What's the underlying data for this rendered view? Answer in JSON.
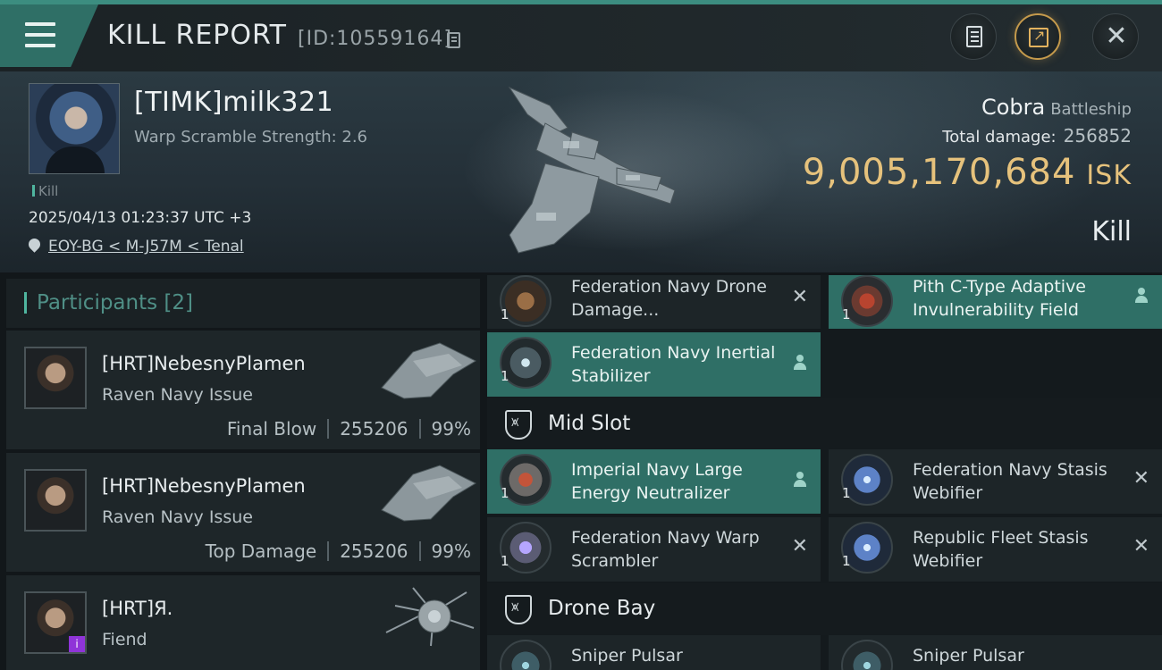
{
  "title_bar": {
    "title": "KILL REPORT",
    "report_id": "[ID:10559164]",
    "icons": [
      "menu-icon",
      "copy-icon",
      "document-icon",
      "share-icon",
      "close-icon"
    ]
  },
  "victim": {
    "name": "[TIMK]milk321",
    "warp_scramble": "Warp Scramble Strength: 2.6",
    "tag": "Kill",
    "datetime": "2025/04/13 01:23:37 UTC +3",
    "location": "EOY-BG < M-J57M < Tenal",
    "ship_name": "Cobra",
    "ship_class": "Battleship",
    "total_damage_label": "Total damage:",
    "total_damage": "256852",
    "isk_value": "9,005,170,684",
    "isk_unit": "ISK",
    "outcome": "Kill"
  },
  "participants": {
    "label": "Participants",
    "count": "[2]",
    "items": [
      {
        "name": "[HRT]NebesnyPlamen",
        "ship": "Raven Navy Issue",
        "role": "Final Blow",
        "damage": "255206",
        "percent": "99%"
      },
      {
        "name": "[HRT]NebesnyPlamen",
        "ship": "Raven Navy Issue",
        "role": "Top Damage",
        "damage": "255206",
        "percent": "99%"
      },
      {
        "name": "[HRT]Я.",
        "ship": "Fiend",
        "badge": "i"
      }
    ]
  },
  "fitting": {
    "low_modules": [
      {
        "name": "Federation Navy Drone Damage...",
        "qty": "1",
        "status": "destroyed",
        "icon": "drone-damage-icon"
      },
      {
        "name": "Pith C-Type Adaptive Invulnerability Field",
        "qty": "1",
        "status": "dropped",
        "icon": "invulnerability-field-icon"
      },
      {
        "name": "Federation Navy Inertial Stabilizer",
        "qty": "1",
        "status": "dropped",
        "icon": "inertial-stabilizer-icon"
      }
    ],
    "mid_slot_label": "Mid Slot",
    "mid_modules": [
      {
        "name": "Imperial Navy Large Energy Neutralizer",
        "qty": "1",
        "status": "dropped",
        "icon": "energy-neutralizer-icon"
      },
      {
        "name": "Federation Navy Stasis Webifier",
        "qty": "1",
        "status": "destroyed",
        "icon": "stasis-webifier-icon"
      },
      {
        "name": "Federation Navy Warp Scrambler",
        "qty": "1",
        "status": "destroyed",
        "icon": "warp-scrambler-icon"
      },
      {
        "name": "Republic Fleet Stasis Webifier",
        "qty": "1",
        "status": "destroyed",
        "icon": "stasis-webifier-icon"
      }
    ],
    "drone_bay_label": "Drone Bay",
    "drones": [
      {
        "name": "Sniper Pulsar",
        "qty": "1",
        "icon": "drone-icon"
      },
      {
        "name": "Sniper Pulsar",
        "qty": "1",
        "icon": "drone-icon"
      }
    ],
    "destroyed_symbol": "✕",
    "colors": {
      "dropped_bg": "#2f6f66",
      "destroyed_bg": "#1d2528",
      "accent": "#4fb59f",
      "isk": "#e6c27c"
    }
  }
}
